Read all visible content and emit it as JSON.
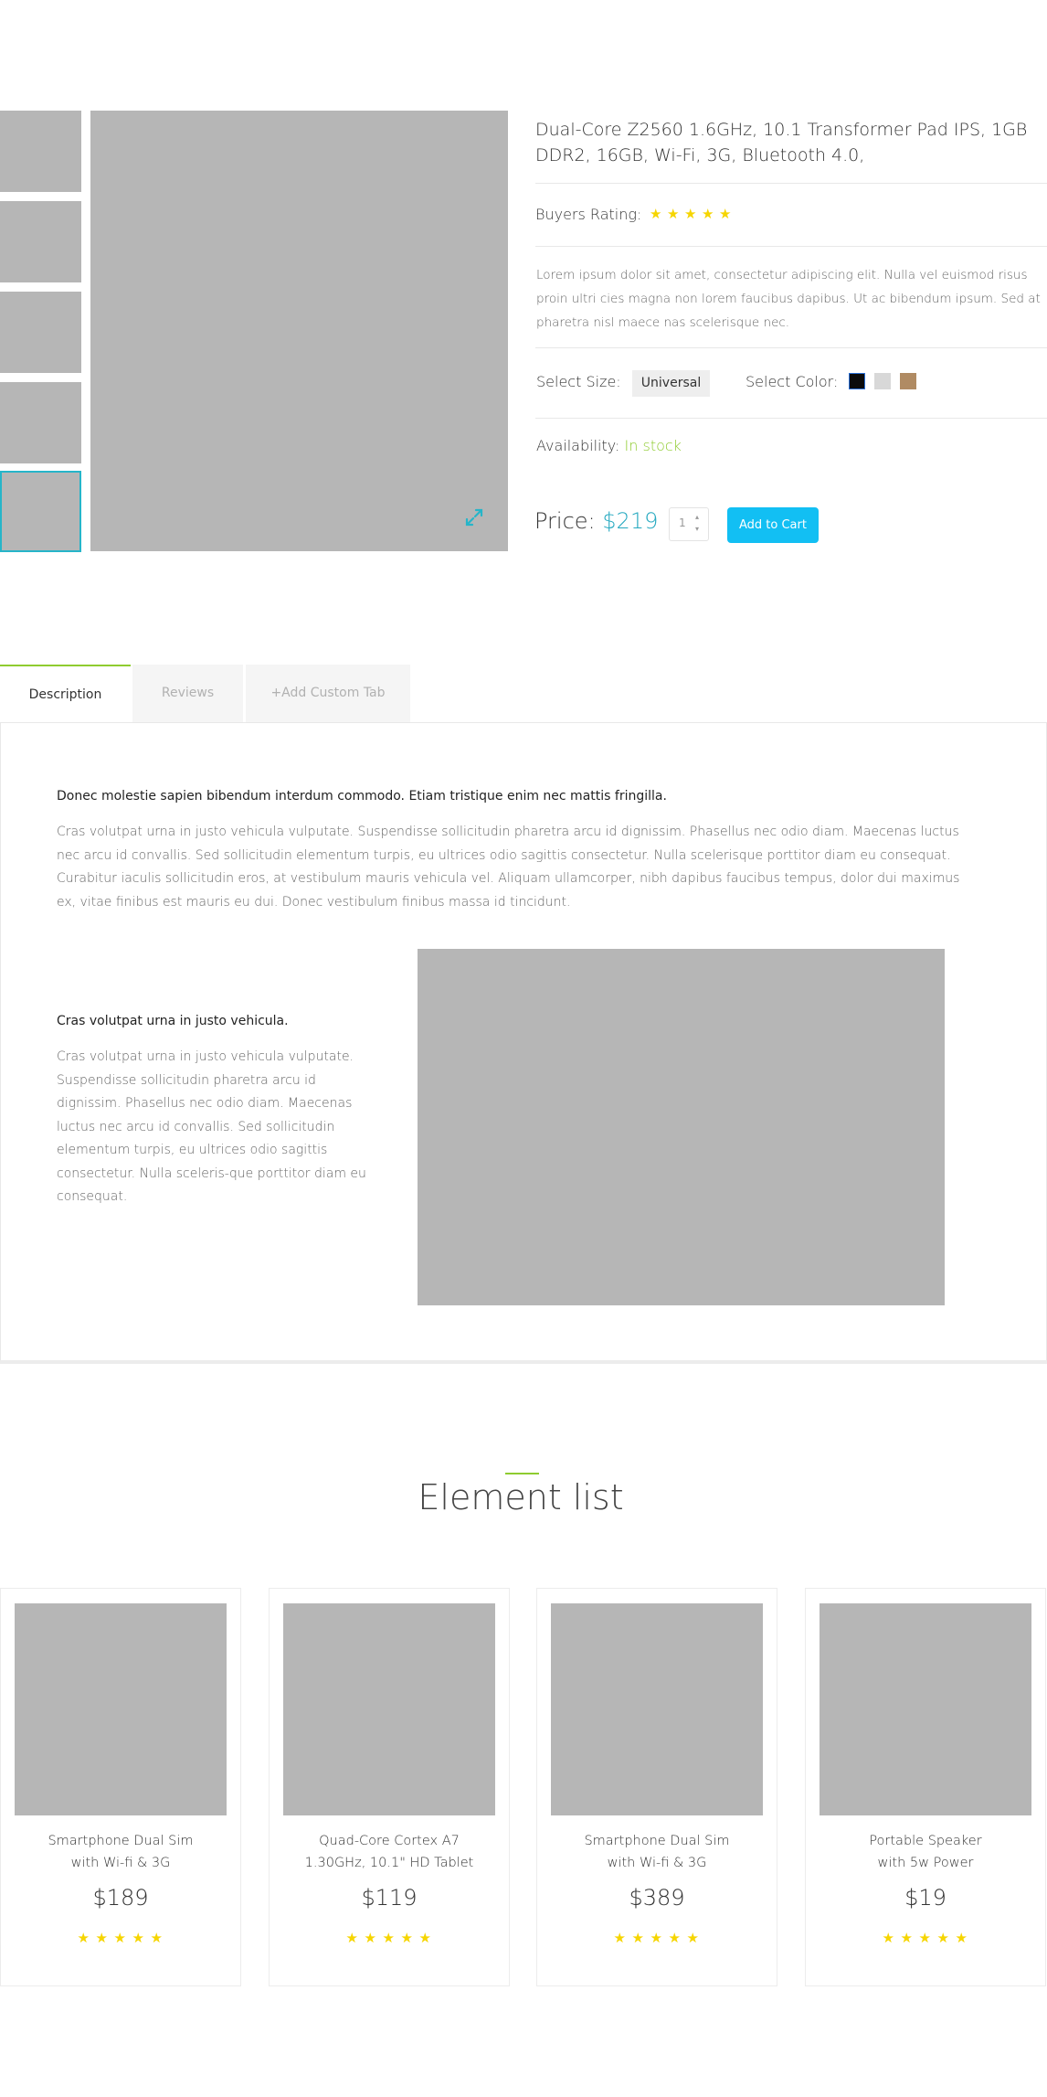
{
  "product": {
    "title": "Dual-Core Z2560 1.6GHz, 10.1 Transformer Pad IPS, 1GB DDR2, 16GB, Wi-Fi, 3G, Bluetooth 4.0,",
    "rating_label": "Buyers Rating:",
    "rating": 5,
    "description": "Lorem ipsum dolor sit amet, consectetur adipiscing elit. Nulla vel euismod risus proin ultri cies magna non lorem faucibus dapibus. Ut ac bibendum ipsum. Sed at pharetra nisl maece nas scelerisque nec.",
    "size_label": "Select Size:",
    "size_value": "Universal",
    "color_label": "Select Color:",
    "colors": [
      "#0b0b0b",
      "#d8d8d8",
      "#b08b63"
    ],
    "availability_label": "Availability:",
    "availability_value": "In stock",
    "price_label": "Price:",
    "price_value": "$219",
    "quantity": "1",
    "add_to_cart": "Add to Cart",
    "accent_color": "#12bff3"
  },
  "tabs": [
    {
      "label": "Description",
      "active": true
    },
    {
      "label": "Reviews",
      "active": false
    },
    {
      "label": "+Add Custom Tab",
      "active": false
    }
  ],
  "description_panel": {
    "heading1": "Donec molestie sapien bibendum interdum commodo. Etiam tristique enim nec mattis fringilla.",
    "paragraph1": "Cras volutpat urna in justo vehicula vulputate. Suspendisse sollicitudin pharetra arcu id dignissim. Phasellus nec odio diam. Maecenas luctus nec arcu id convallis. Sed sollicitudin elementum turpis, eu ultrices odio sagittis consectetur. Nulla scelerisque porttitor diam eu consequat. Curabitur iaculis sollicitudin eros, at vestibulum mauris vehicula vel. Aliquam ullamcorper, nibh dapibus faucibus tempus, dolor dui maximus ex, vitae finibus est mauris eu dui. Donec vestibulum finibus massa id tincidunt.",
    "heading2": "Cras volutpat urna in justo vehicula.",
    "paragraph2": "Cras volutpat urna in justo vehicula vulputate. Suspendisse sollicitudin pharetra arcu id dignissim. Phasellus nec odio diam. Maecenas luctus nec arcu id convallis. Sed sollicitudin elementum turpis, eu ultrices odio sagittis consectetur. Nulla sceleris-que porttitor diam eu consequat."
  },
  "element_list": {
    "title": "Element list",
    "items": [
      {
        "name_line1": "Smartphone Dual Sim",
        "name_line2": "with Wi-fi & 3G",
        "price": "$189",
        "rating": 5
      },
      {
        "name_line1": "Quad-Core Cortex A7",
        "name_line2": "1.30GHz, 10.1\" HD Tablet",
        "price": "$119",
        "rating": 5
      },
      {
        "name_line1": "Smartphone Dual Sim",
        "name_line2": "with Wi-fi & 3G",
        "price": "$389",
        "rating": 5
      },
      {
        "name_line1": "Portable Speaker",
        "name_line2": "with 5w Power",
        "price": "$19",
        "rating": 5
      }
    ]
  }
}
